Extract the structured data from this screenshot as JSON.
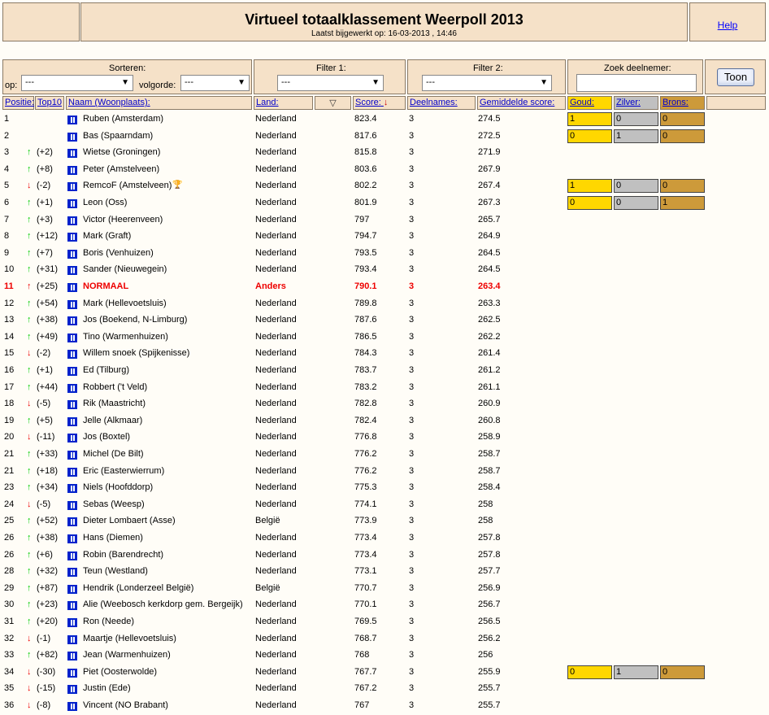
{
  "header": {
    "title": "Virtueel totaalklassement Weerpoll 2013",
    "updated": "Laatst bijgewerkt op: 16-03-2013 , 14:46",
    "help": "Help"
  },
  "controls": {
    "sort_label": "Sorteren:",
    "op_label": "op:",
    "op_value": "---",
    "order_label": "volgorde:",
    "order_value": "---",
    "filter1_label": "Filter 1:",
    "filter1_value": "---",
    "filter2_label": "Filter 2:",
    "filter2_value": "---",
    "search_label": "Zoek deelnemer:",
    "search_value": "",
    "button": "Toon"
  },
  "columns": {
    "pos": "Positie:",
    "top10": "Top10",
    "name": "Naam (Woonplaats):",
    "land": "Land:",
    "score": "Score:",
    "deel": "Deelnames:",
    "avg": "Gemiddelde score:",
    "goud": "Goud:",
    "zilver": "Zilver:",
    "brons": "Brons:"
  },
  "icons": {
    "filter": "filter-icon",
    "sort": "sort-desc-arrow-icon",
    "flag": "flag-icon",
    "trophy": "trophy-icon"
  },
  "colors": {
    "panel": "#f5e1c8",
    "gold": "#ffd700",
    "silver": "#c0c0c0",
    "bronze": "#cd9a3a",
    "highlight": "#e00000",
    "up": "#00cc00"
  },
  "rows": [
    {
      "pos": "1",
      "dir": "",
      "chg": "",
      "name": "Ruben (Amsterdam)",
      "land": "Nederland",
      "score": "823.4",
      "deel": "3",
      "avg": "274.5",
      "medals": [
        "1",
        "0",
        "0"
      ]
    },
    {
      "pos": "2",
      "dir": "",
      "chg": "",
      "name": "Bas (Spaarndam)",
      "land": "Nederland",
      "score": "817.6",
      "deel": "3",
      "avg": "272.5",
      "medals": [
        "0",
        "1",
        "0"
      ]
    },
    {
      "pos": "3",
      "dir": "up",
      "chg": "(+2)",
      "name": "Wietse (Groningen)",
      "land": "Nederland",
      "score": "815.8",
      "deel": "3",
      "avg": "271.9"
    },
    {
      "pos": "4",
      "dir": "up",
      "chg": "(+8)",
      "name": "Peter (Amstelveen)",
      "land": "Nederland",
      "score": "803.6",
      "deel": "3",
      "avg": "267.9"
    },
    {
      "pos": "5",
      "dir": "down",
      "chg": "(-2)",
      "name": "RemcoF (Amstelveen)",
      "land": "Nederland",
      "score": "802.2",
      "deel": "3",
      "avg": "267.4",
      "medals": [
        "1",
        "0",
        "0"
      ],
      "trophy": true
    },
    {
      "pos": "6",
      "dir": "up",
      "chg": "(+1)",
      "name": "Leon (Oss)",
      "land": "Nederland",
      "score": "801.9",
      "deel": "3",
      "avg": "267.3",
      "medals": [
        "0",
        "0",
        "1"
      ]
    },
    {
      "pos": "7",
      "dir": "up",
      "chg": "(+3)",
      "name": "Victor (Heerenveen)",
      "land": "Nederland",
      "score": "797",
      "deel": "3",
      "avg": "265.7"
    },
    {
      "pos": "8",
      "dir": "up",
      "chg": "(+12)",
      "name": "Mark (Graft)",
      "land": "Nederland",
      "score": "794.7",
      "deel": "3",
      "avg": "264.9"
    },
    {
      "pos": "9",
      "dir": "up",
      "chg": "(+7)",
      "name": "Boris (Venhuizen)",
      "land": "Nederland",
      "score": "793.5",
      "deel": "3",
      "avg": "264.5"
    },
    {
      "pos": "10",
      "dir": "up",
      "chg": "(+31)",
      "name": "Sander (Nieuwegein)",
      "land": "Nederland",
      "score": "793.4",
      "deel": "3",
      "avg": "264.5"
    },
    {
      "pos": "11",
      "dir": "up",
      "chg": "(+25)",
      "name": "NORMAAL",
      "land": "Anders",
      "score": "790.1",
      "deel": "3",
      "avg": "263.4",
      "hl": true
    },
    {
      "pos": "12",
      "dir": "up",
      "chg": "(+54)",
      "name": "Mark (Hellevoetsluis)",
      "land": "Nederland",
      "score": "789.8",
      "deel": "3",
      "avg": "263.3"
    },
    {
      "pos": "13",
      "dir": "up",
      "chg": "(+38)",
      "name": "Jos (Boekend, N-Limburg)",
      "land": "Nederland",
      "score": "787.6",
      "deel": "3",
      "avg": "262.5"
    },
    {
      "pos": "14",
      "dir": "up",
      "chg": "(+49)",
      "name": "Tino (Warmenhuizen)",
      "land": "Nederland",
      "score": "786.5",
      "deel": "3",
      "avg": "262.2"
    },
    {
      "pos": "15",
      "dir": "down",
      "chg": "(-2)",
      "name": "Willem snoek (Spijkenisse)",
      "land": "Nederland",
      "score": "784.3",
      "deel": "3",
      "avg": "261.4"
    },
    {
      "pos": "16",
      "dir": "up",
      "chg": "(+1)",
      "name": "Ed (Tilburg)",
      "land": "Nederland",
      "score": "783.7",
      "deel": "3",
      "avg": "261.2"
    },
    {
      "pos": "17",
      "dir": "up",
      "chg": "(+44)",
      "name": "Robbert ('t Veld)",
      "land": "Nederland",
      "score": "783.2",
      "deel": "3",
      "avg": "261.1"
    },
    {
      "pos": "18",
      "dir": "down",
      "chg": "(-5)",
      "name": "Rik (Maastricht)",
      "land": "Nederland",
      "score": "782.8",
      "deel": "3",
      "avg": "260.9"
    },
    {
      "pos": "19",
      "dir": "up",
      "chg": "(+5)",
      "name": "Jelle (Alkmaar)",
      "land": "Nederland",
      "score": "782.4",
      "deel": "3",
      "avg": "260.8"
    },
    {
      "pos": "20",
      "dir": "down",
      "chg": "(-11)",
      "name": "Jos (Boxtel)",
      "land": "Nederland",
      "score": "776.8",
      "deel": "3",
      "avg": "258.9"
    },
    {
      "pos": "21",
      "dir": "up",
      "chg": "(+33)",
      "name": "Michel (De Bilt)",
      "land": "Nederland",
      "score": "776.2",
      "deel": "3",
      "avg": "258.7"
    },
    {
      "pos": "21",
      "dir": "up",
      "chg": "(+18)",
      "name": "Eric (Easterwierrum)",
      "land": "Nederland",
      "score": "776.2",
      "deel": "3",
      "avg": "258.7"
    },
    {
      "pos": "23",
      "dir": "up",
      "chg": "(+34)",
      "name": "Niels (Hoofddorp)",
      "land": "Nederland",
      "score": "775.3",
      "deel": "3",
      "avg": "258.4"
    },
    {
      "pos": "24",
      "dir": "down",
      "chg": "(-5)",
      "name": "Sebas (Weesp)",
      "land": "Nederland",
      "score": "774.1",
      "deel": "3",
      "avg": "258"
    },
    {
      "pos": "25",
      "dir": "up",
      "chg": "(+52)",
      "name": "Dieter Lombaert (Asse)",
      "land": "België",
      "score": "773.9",
      "deel": "3",
      "avg": "258"
    },
    {
      "pos": "26",
      "dir": "up",
      "chg": "(+38)",
      "name": "Hans (Diemen)",
      "land": "Nederland",
      "score": "773.4",
      "deel": "3",
      "avg": "257.8"
    },
    {
      "pos": "26",
      "dir": "up",
      "chg": "(+6)",
      "name": "Robin (Barendrecht)",
      "land": "Nederland",
      "score": "773.4",
      "deel": "3",
      "avg": "257.8"
    },
    {
      "pos": "28",
      "dir": "up",
      "chg": "(+32)",
      "name": "Teun (Westland)",
      "land": "Nederland",
      "score": "773.1",
      "deel": "3",
      "avg": "257.7"
    },
    {
      "pos": "29",
      "dir": "up",
      "chg": "(+87)",
      "name": "Hendrik (Londerzeel België)",
      "land": "België",
      "score": "770.7",
      "deel": "3",
      "avg": "256.9"
    },
    {
      "pos": "30",
      "dir": "up",
      "chg": "(+23)",
      "name": "Alie (Weebosch kerkdorp gem. Bergeijk)",
      "land": "Nederland",
      "score": "770.1",
      "deel": "3",
      "avg": "256.7"
    },
    {
      "pos": "31",
      "dir": "up",
      "chg": "(+20)",
      "name": "Ron (Neede)",
      "land": "Nederland",
      "score": "769.5",
      "deel": "3",
      "avg": "256.5"
    },
    {
      "pos": "32",
      "dir": "down",
      "chg": "(-1)",
      "name": "Maartje (Hellevoetsluis)",
      "land": "Nederland",
      "score": "768.7",
      "deel": "3",
      "avg": "256.2"
    },
    {
      "pos": "33",
      "dir": "up",
      "chg": "(+82)",
      "name": "Jean (Warmenhuizen)",
      "land": "Nederland",
      "score": "768",
      "deel": "3",
      "avg": "256"
    },
    {
      "pos": "34",
      "dir": "down",
      "chg": "(-30)",
      "name": "Piet (Oosterwolde)",
      "land": "Nederland",
      "score": "767.7",
      "deel": "3",
      "avg": "255.9",
      "medals": [
        "0",
        "1",
        "0"
      ]
    },
    {
      "pos": "35",
      "dir": "down",
      "chg": "(-15)",
      "name": "Justin (Ede)",
      "land": "Nederland",
      "score": "767.2",
      "deel": "3",
      "avg": "255.7"
    },
    {
      "pos": "36",
      "dir": "down",
      "chg": "(-8)",
      "name": "Vincent (NO Brabant)",
      "land": "Nederland",
      "score": "767",
      "deel": "3",
      "avg": "255.7"
    }
  ]
}
